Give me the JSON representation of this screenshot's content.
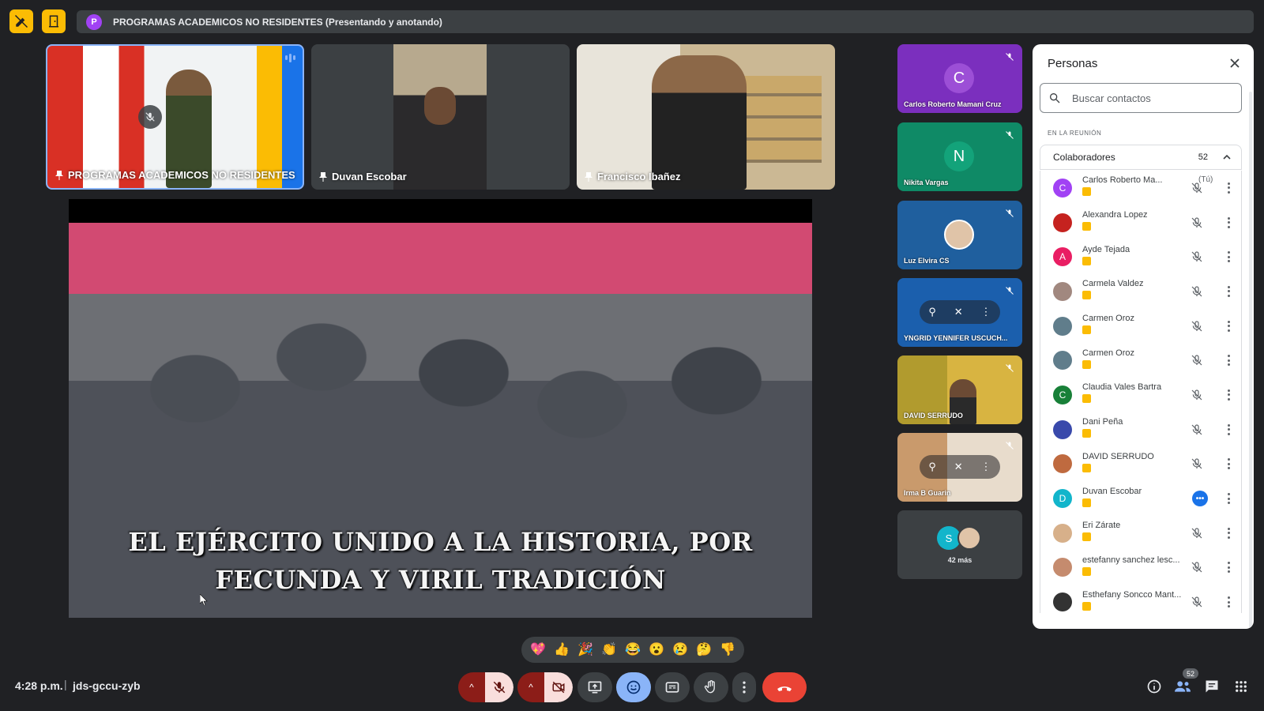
{
  "header": {
    "presenter_initial": "P",
    "presenting_text": "PROGRAMAS ACADEMICOS NO RESIDENTES (Presentando y anotando)"
  },
  "tiles": {
    "main_presenter": "PROGRAMAS ACADEMICOS NO RESIDENTES",
    "tile2": "Duvan Escobar",
    "tile3": "Francisco Ibañez"
  },
  "presentation": {
    "caption_line1": "EL EJÉRCITO UNIDO A LA HISTORIA, POR",
    "caption_line2": "FECUNDA Y VIRIL TRADICIÓN"
  },
  "side_tiles": [
    {
      "name": "Carlos Roberto Mamani Cruz",
      "initial": "C",
      "bg": "#7b2fbe",
      "avatar_bg": "#9c4fd6"
    },
    {
      "name": "Nikita Vargas",
      "initial": "N",
      "bg": "#0f8a66",
      "avatar_bg": "#13a37a"
    },
    {
      "name": "Luz Elvira CS",
      "initial": "",
      "bg": "#1f5f9e"
    },
    {
      "name": "YNGRID YENNIFER USCUCH...",
      "initial": "",
      "bg": "#1b5fad"
    },
    {
      "name": "DAVID SERRUDO",
      "initial": "",
      "bg": "#8a7a2c"
    },
    {
      "name": "Irma B Guarin",
      "initial": "",
      "bg": "#b98a5a"
    },
    {
      "name": "42 más",
      "initial": "S",
      "bg": "#3c4043"
    }
  ],
  "people_panel": {
    "title": "Personas",
    "search_placeholder": "Buscar contactos",
    "section_label": "EN LA REUNIÓN",
    "group_label": "Colaboradores",
    "group_count": "52",
    "participants": [
      {
        "name": "Carlos Roberto Ma...",
        "suffix": "(Tú)",
        "initial": "C",
        "color": "#a142f4"
      },
      {
        "name": "Alexandra Lopez",
        "suffix": "",
        "initial": "",
        "color": "#c5221f"
      },
      {
        "name": "Ayde Tejada",
        "suffix": "",
        "initial": "A",
        "color": "#e91e63"
      },
      {
        "name": "Carmela Valdez",
        "suffix": "",
        "initial": "",
        "color": "#a1887f"
      },
      {
        "name": "Carmen Oroz",
        "suffix": "",
        "initial": "",
        "color": "#607d8b"
      },
      {
        "name": "Carmen Oroz",
        "suffix": "",
        "initial": "",
        "color": "#607d8b"
      },
      {
        "name": "Claudia Vales Bartra",
        "suffix": "",
        "initial": "C",
        "color": "#188038"
      },
      {
        "name": "Dani Peña",
        "suffix": "",
        "initial": "",
        "color": "#3949ab"
      },
      {
        "name": "DAVID SERRUDO",
        "suffix": "",
        "initial": "",
        "color": "#bf6a3f"
      },
      {
        "name": "Duvan Escobar",
        "suffix": "",
        "initial": "D",
        "color": "#12b5cb"
      },
      {
        "name": "Eri Zárate",
        "suffix": "",
        "initial": "",
        "color": "#d7b08a"
      },
      {
        "name": "estefanny sanchez lesc...",
        "suffix": "",
        "initial": "",
        "color": "#c58b6e"
      },
      {
        "name": "Esthefany Soncco Mant...",
        "suffix": "",
        "initial": "",
        "color": "#333333"
      }
    ]
  },
  "reactions": [
    "💖",
    "👍",
    "🎉",
    "👏",
    "😂",
    "😮",
    "😢",
    "🤔",
    "👎"
  ],
  "bottom_bar": {
    "time": "4:28 p.m.",
    "separator": "|",
    "meeting_code": "jds-gccu-zyb",
    "people_count": "52"
  }
}
